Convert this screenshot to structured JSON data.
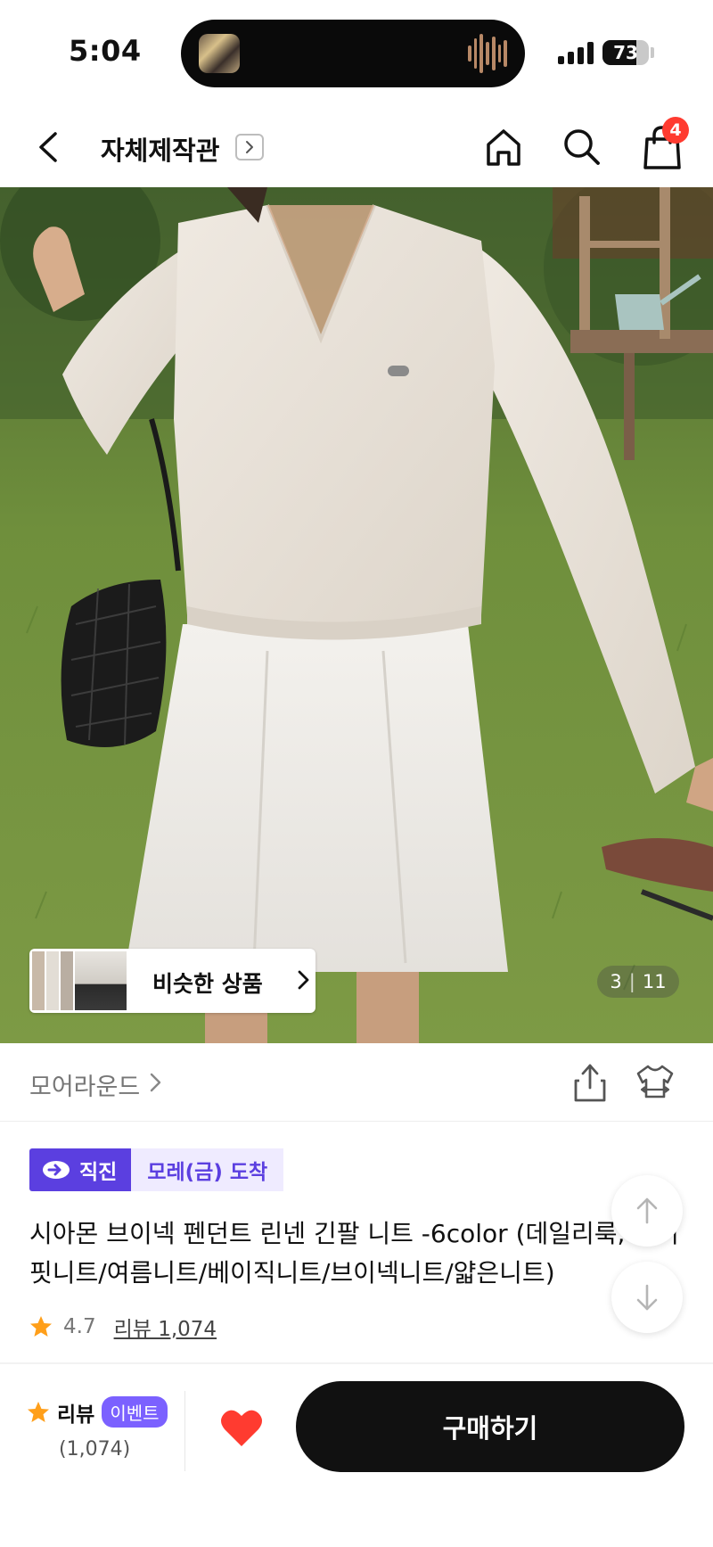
{
  "status_bar": {
    "time": "5:04",
    "battery": "73",
    "battery_level": 0.73
  },
  "header": {
    "title": "자체제작관"
  },
  "cart": {
    "badge_count": "4"
  },
  "gallery": {
    "similar_label": "비슷한 상품",
    "current_page": "3",
    "total_pages": "11",
    "separator": "|"
  },
  "shop": {
    "name": "모어라운드"
  },
  "product": {
    "badge_direct": "직진",
    "badge_arrival": "모레(금) 도착",
    "name_line1": "시아몬 브이넥 펜던트 린넨 긴팔 니트 -6color (데일리룩, 오버",
    "name_line2": "핏니트/여름니트/베이직니트/브이넥니트/얇은니트)",
    "rating": "4.7",
    "review_link": "리뷰 1,074"
  },
  "bottom_bar": {
    "review_label": "리뷰",
    "event_badge": "이벤트",
    "review_count": "(1,074)",
    "buy_label": "구매하기"
  },
  "colors": {
    "accent": "#5b3fe0",
    "accent_light": "#efebff",
    "event": "#7b61ff",
    "star": "#ff9f1a",
    "heart": "#ff3b30",
    "badge": "#ff3b30",
    "buy_button": "#111111"
  },
  "icons": {
    "back": "chevron-left-icon",
    "home": "home-icon",
    "search": "search-icon",
    "cart": "shopping-bag-icon",
    "share": "share-icon",
    "fit": "garment-fit-icon",
    "star": "star-icon",
    "heart": "heart-icon",
    "scroll_up": "arrow-up-icon",
    "scroll_down": "arrow-down-icon"
  }
}
